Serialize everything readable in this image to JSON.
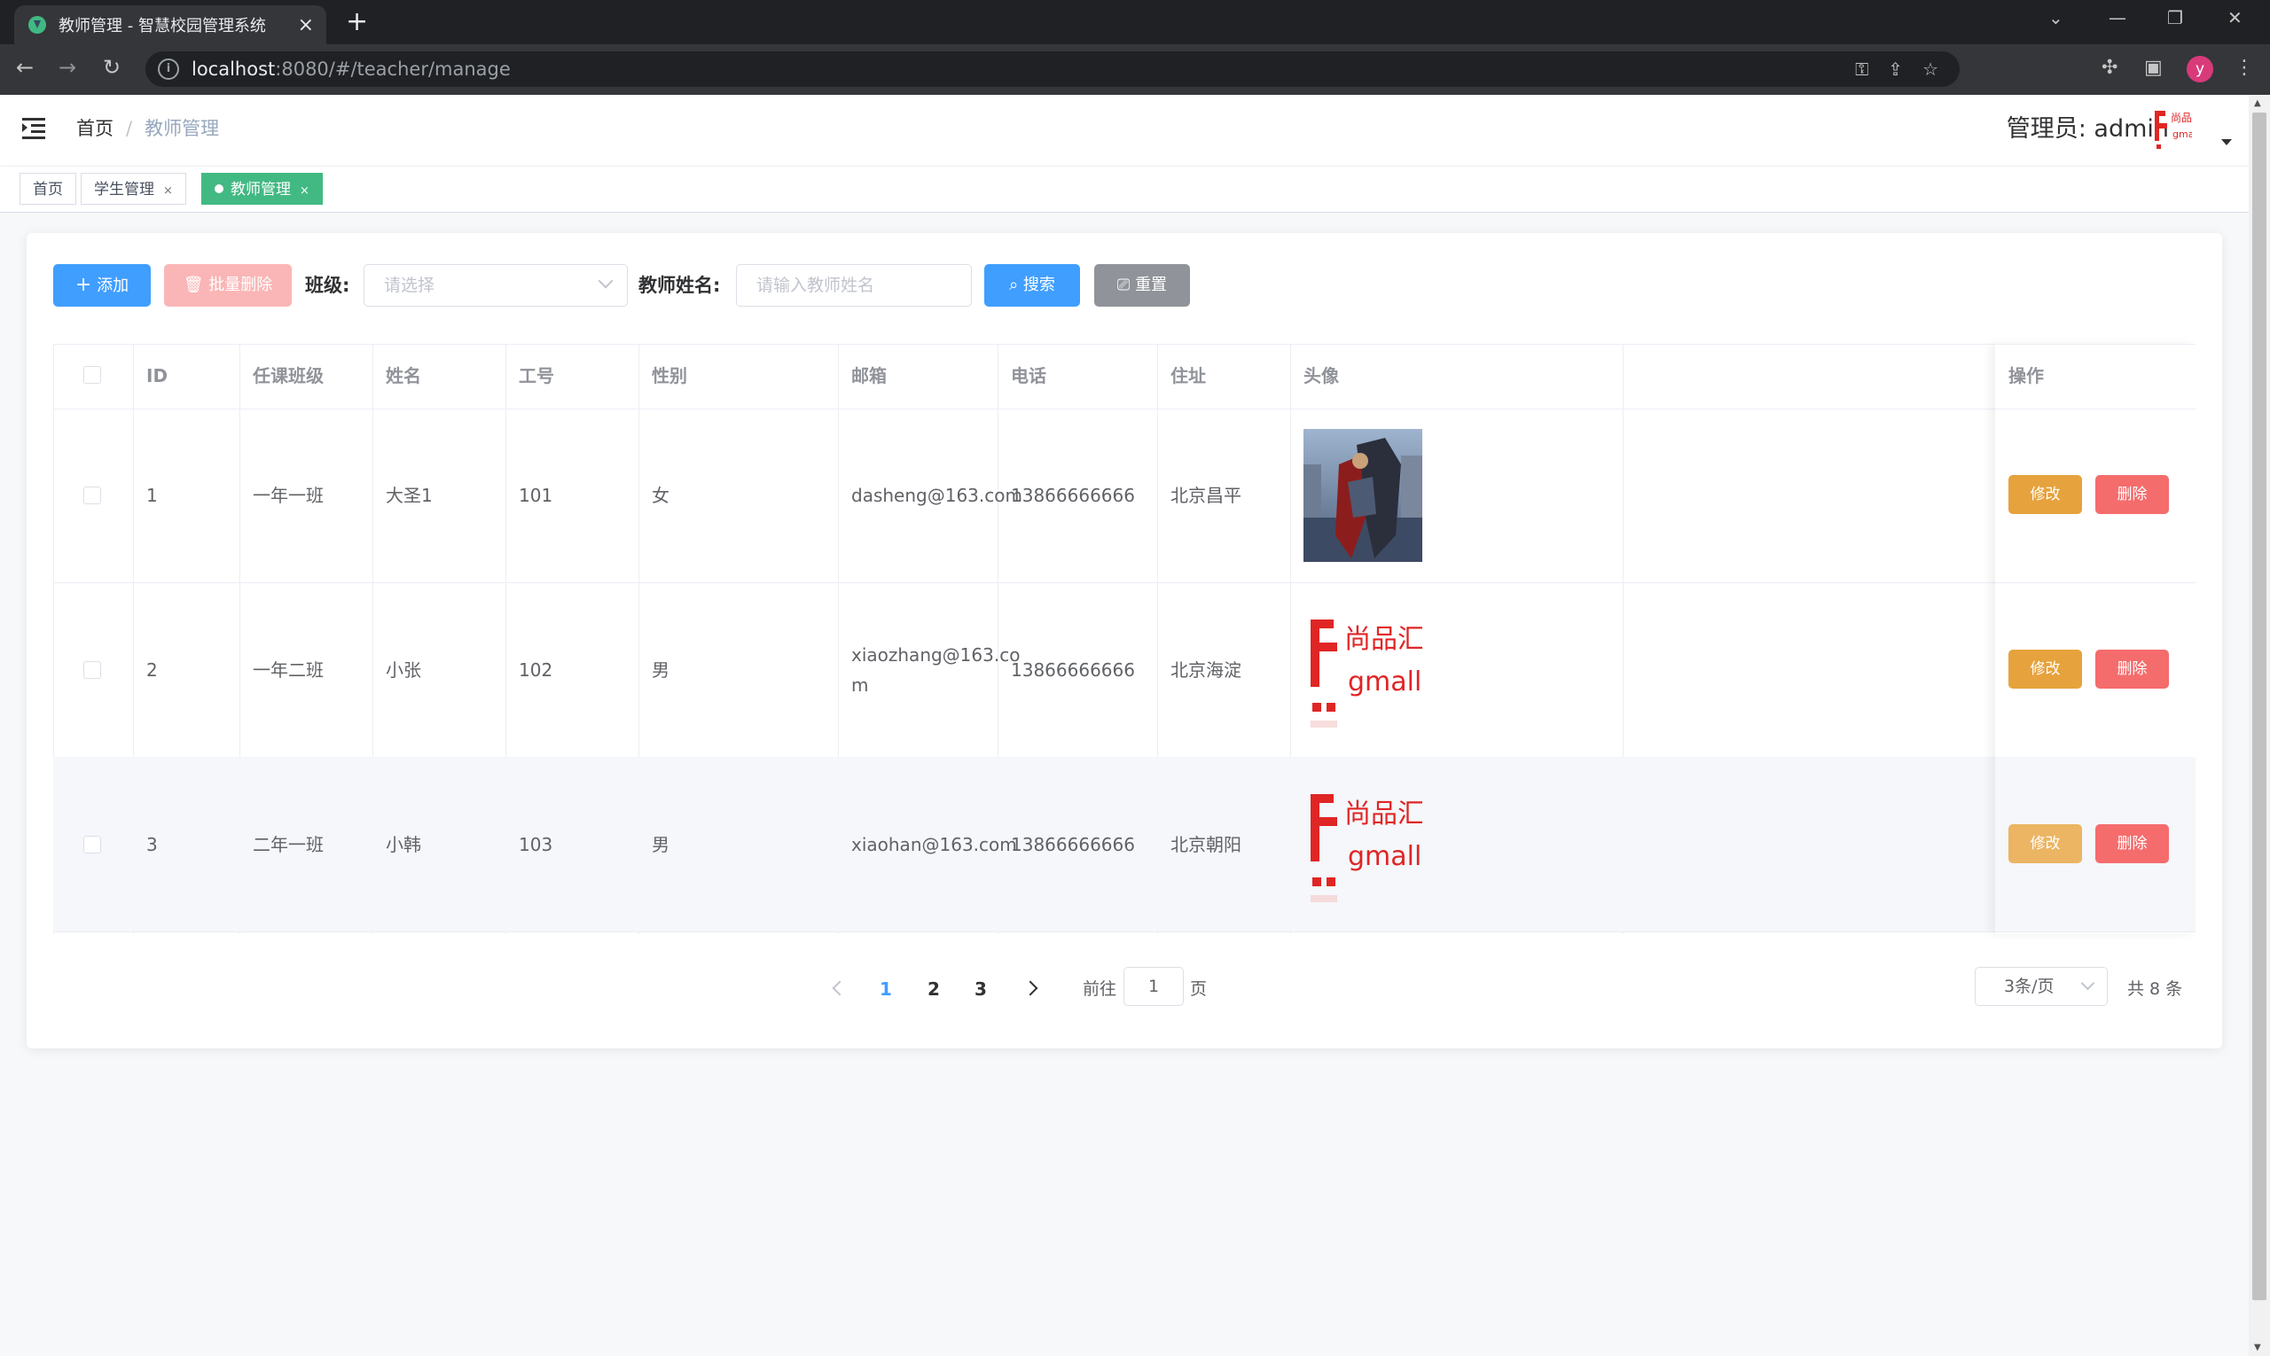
{
  "browser": {
    "tab_title": "教师管理 - 智慧校园管理系统",
    "url_host": "localhost",
    "url_rest": ":8080/#/teacher/manage",
    "profile_initial": "y"
  },
  "header": {
    "breadcrumb": [
      "首页",
      "教师管理"
    ],
    "user_label": "管理员: admin"
  },
  "tags": [
    {
      "label": "首页",
      "closable": false,
      "active": false
    },
    {
      "label": "学生管理",
      "closable": true,
      "active": false
    },
    {
      "label": "教师管理",
      "closable": true,
      "active": true
    }
  ],
  "toolbar": {
    "add_label": "添加",
    "batch_delete_label": "批量删除",
    "class_label": "班级:",
    "class_placeholder": "请选择",
    "name_label": "教师姓名:",
    "name_placeholder": "请输入教师姓名",
    "search_label": "搜索",
    "reset_label": "重置"
  },
  "table": {
    "columns": [
      "ID",
      "任课班级",
      "姓名",
      "工号",
      "性别",
      "邮箱",
      "电话",
      "住址",
      "头像",
      "操作"
    ],
    "rows": [
      {
        "id": "1",
        "class": "一年一班",
        "name": "大圣1",
        "tno": "101",
        "gender": "女",
        "email": "dasheng@163.com",
        "phone": "13866666666",
        "address": "北京昌平",
        "avatar": "warrior-image"
      },
      {
        "id": "2",
        "class": "一年二班",
        "name": "小张",
        "tno": "102",
        "gender": "男",
        "email": "xiaozhang@163.com",
        "phone": "13866666666",
        "address": "北京海淀",
        "avatar": "gmall-logo"
      },
      {
        "id": "3",
        "class": "二年一班",
        "name": "小韩",
        "tno": "103",
        "gender": "男",
        "email": "xiaohan@163.com",
        "phone": "13866666666",
        "address": "北京朝阳",
        "avatar": "gmall-logo"
      }
    ],
    "edit_label": "修改",
    "delete_label": "删除"
  },
  "pagination": {
    "pages": [
      "1",
      "2",
      "3"
    ],
    "current": "1",
    "goto_label": "前往",
    "goto_value": "1",
    "page_suffix": "页",
    "page_size": "3条/页",
    "total": "共 8 条"
  },
  "logo_text": {
    "cn": "尚品汇",
    "en": "gmall"
  },
  "colors": {
    "primary": "#409eff",
    "success_tag": "#42b983",
    "warning": "#e6a23c",
    "danger": "#f56c6c",
    "info": "#909399"
  }
}
